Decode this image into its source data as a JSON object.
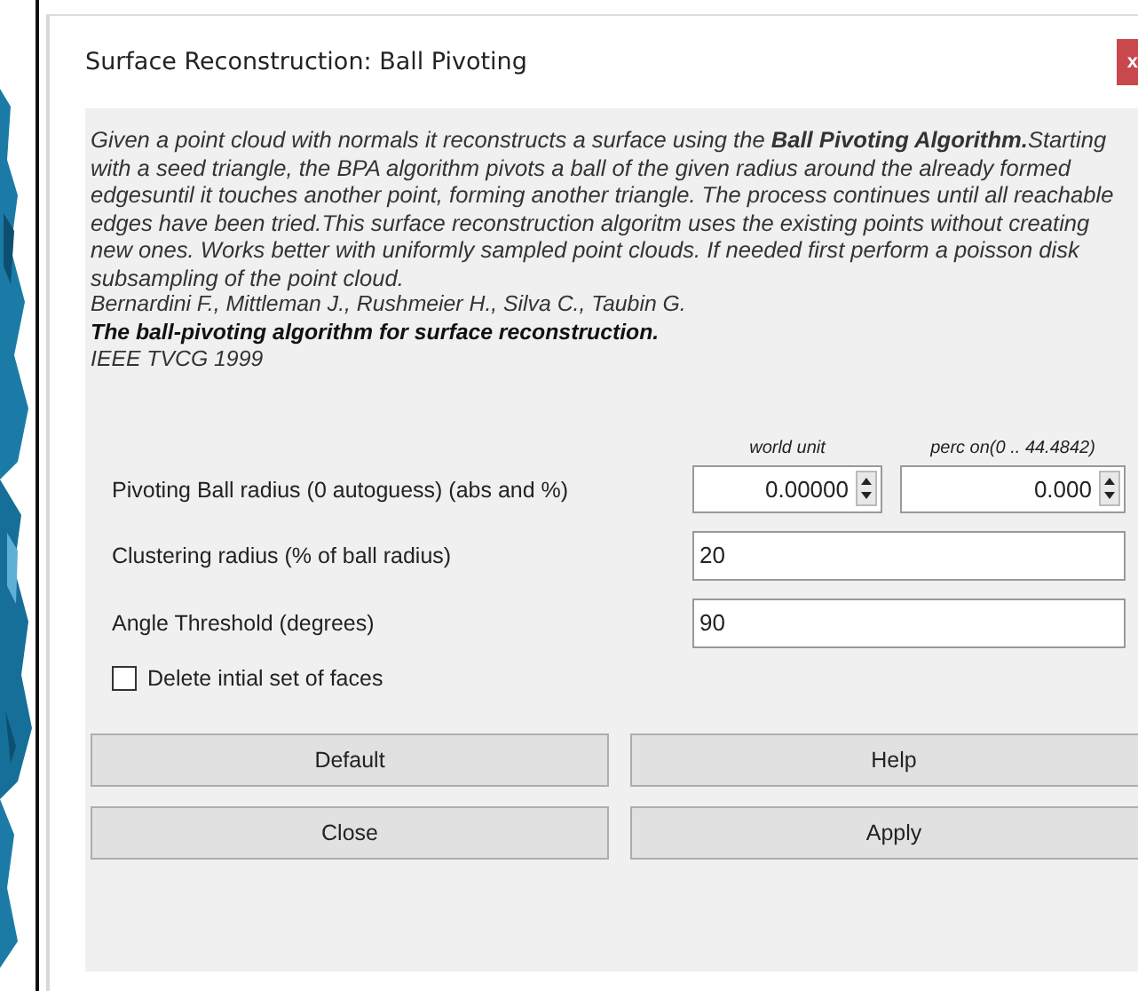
{
  "window": {
    "title": "Surface Reconstruction: Ball Pivoting",
    "close": "x"
  },
  "description": {
    "text": "Given a point cloud with normals it reconstructs a surface using the **Ball Pivoting Algorithm.**Starting with a seed triangle, the BPA algorithm pivots a ball of the given radius around the already formed edgesuntil it touches another point, forming another triangle. The process continues until all reachable edges have been tried.This surface reconstruction algoritm uses the existing points without creating new ones. Works better with uniformly sampled point clouds. If needed first perform a poisson disk subsampling of the point cloud.",
    "authors": "Bernardini F., Mittleman J., Rushmeier H., Silva C., Taubin G.",
    "paper_title": "The ball-pivoting algorithm for surface reconstruction.",
    "journal": "IEEE TVCG 1999"
  },
  "parameters": [
    {
      "kind": "spin_pair",
      "label": "Pivoting Ball radius (0 autoguess) (abs and %)",
      "headers": [
        "world unit",
        "perc on(0 .. 44.4842)"
      ],
      "values": [
        "0.00000",
        "0.000"
      ]
    },
    {
      "kind": "text",
      "label": "Clustering radius (% of ball radius)",
      "value": "20"
    },
    {
      "kind": "text",
      "label": "Angle Threshold (degrees)",
      "value": "90"
    },
    {
      "kind": "checkbox",
      "label": "Delete intial set of faces",
      "checked": false
    }
  ],
  "buttons": [
    "Default",
    "Help",
    "Close",
    "Apply"
  ]
}
